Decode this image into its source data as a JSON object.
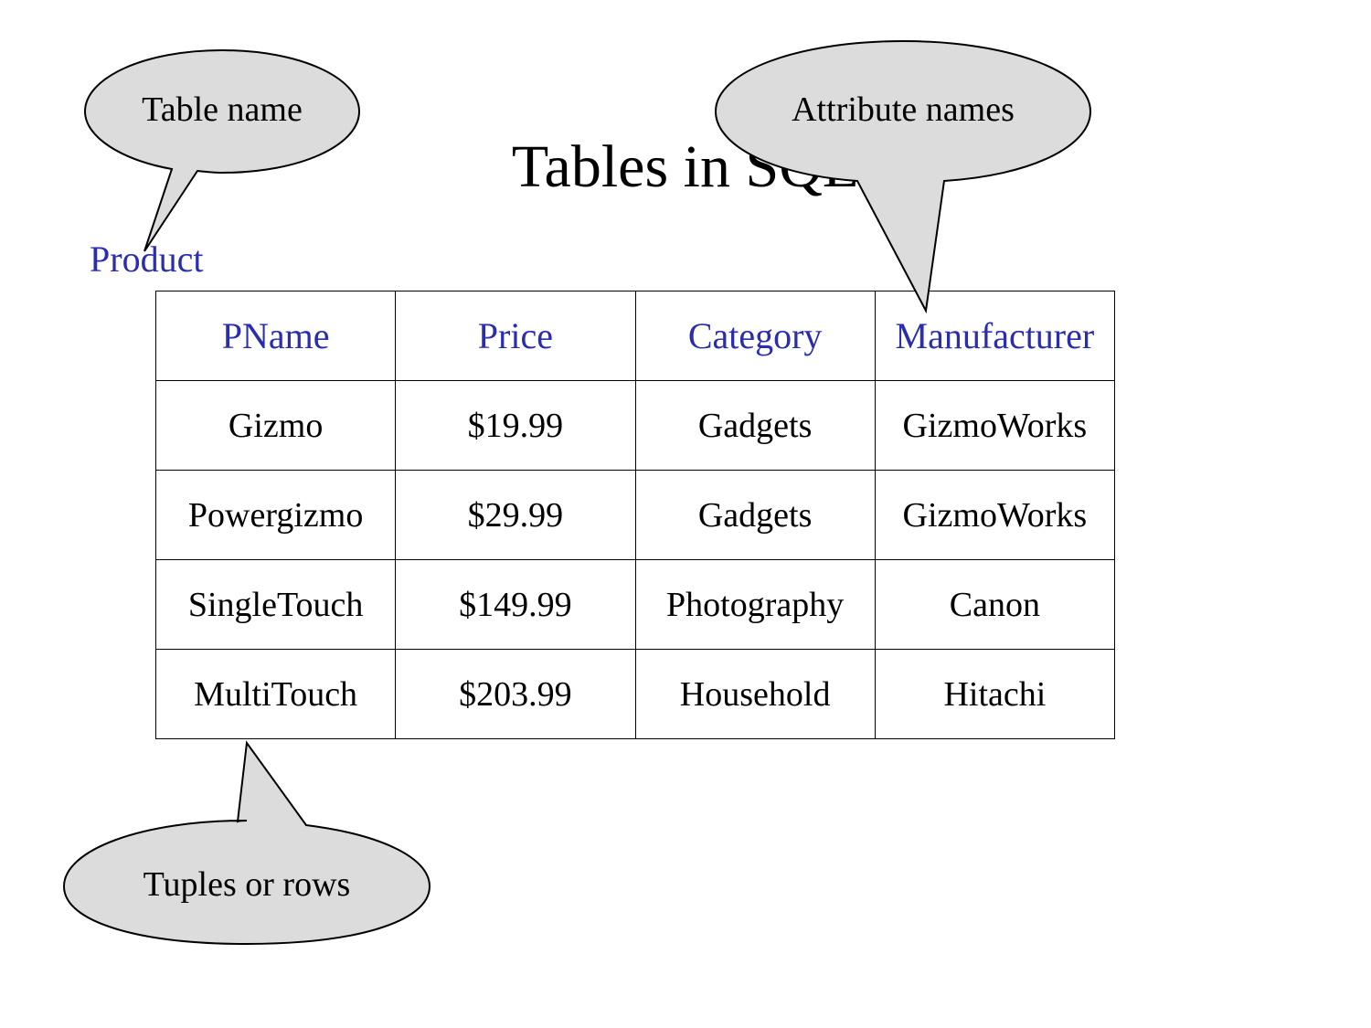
{
  "title": "Tables in SQL",
  "table_name_label": "Product",
  "callouts": {
    "table_name": "Table name",
    "attribute_names": "Attribute names",
    "tuples": "Tuples or rows"
  },
  "columns": [
    "PName",
    "Price",
    "Category",
    "Manufacturer"
  ],
  "rows": [
    {
      "PName": "Gizmo",
      "Price": "$19.99",
      "Category": "Gadgets",
      "Manufacturer": "GizmoWorks"
    },
    {
      "PName": "Powergizmo",
      "Price": "$29.99",
      "Category": "Gadgets",
      "Manufacturer": "GizmoWorks"
    },
    {
      "PName": "SingleTouch",
      "Price": "$149.99",
      "Category": "Photography",
      "Manufacturer": "Canon"
    },
    {
      "PName": "MultiTouch",
      "Price": "$203.99",
      "Category": "Household",
      "Manufacturer": "Hitachi"
    }
  ],
  "colors": {
    "accent": "#2a2db0",
    "callout_fill": "#dcdcdc",
    "callout_stroke": "#000000"
  }
}
